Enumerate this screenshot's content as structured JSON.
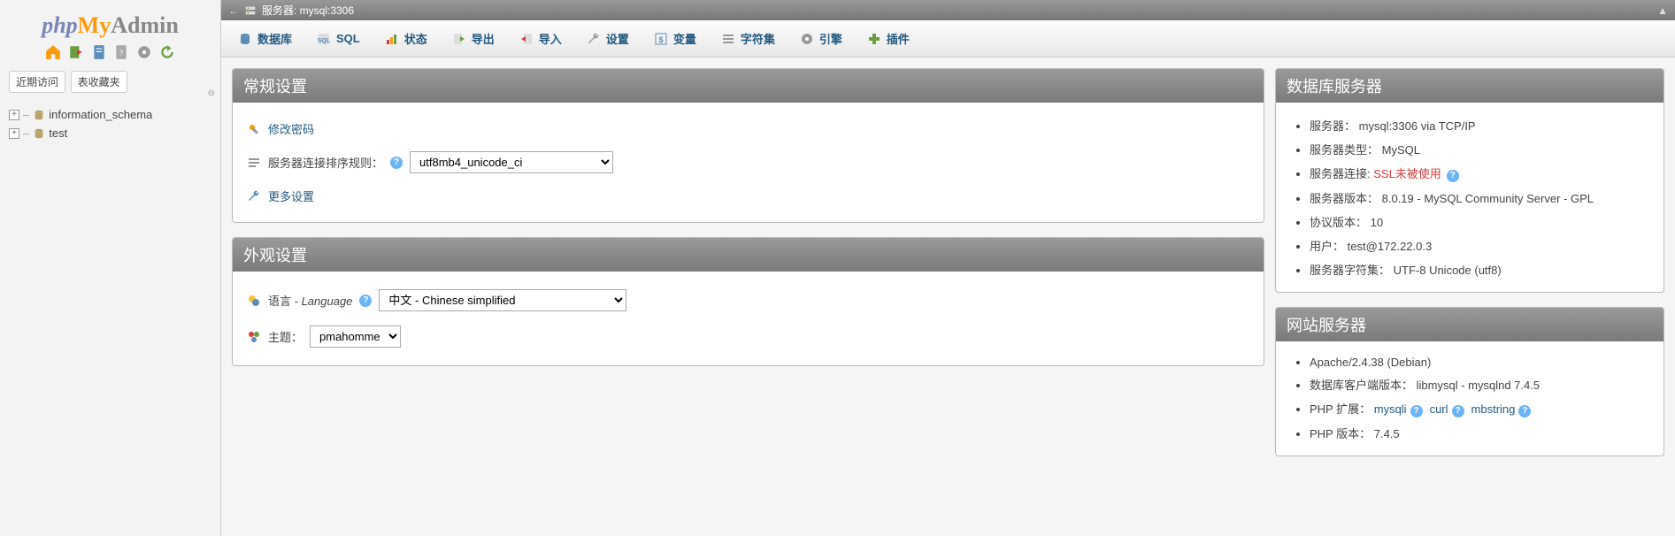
{
  "logo": {
    "php": "php",
    "my": "My",
    "admin": "Admin"
  },
  "sidebar": {
    "tabs": {
      "recent": "近期访问",
      "fav": "表收藏夹"
    },
    "dbs": [
      "information_schema",
      "test"
    ]
  },
  "breadcrumb": {
    "label": "服务器: mysql:3306"
  },
  "topmenu": [
    {
      "label": "数据库"
    },
    {
      "label": "SQL"
    },
    {
      "label": "状态"
    },
    {
      "label": "导出"
    },
    {
      "label": "导入"
    },
    {
      "label": "设置"
    },
    {
      "label": "变量"
    },
    {
      "label": "字符集"
    },
    {
      "label": "引擎"
    },
    {
      "label": "插件"
    }
  ],
  "general": {
    "title": "常规设置",
    "change_pw": "修改密码",
    "collation_label": "服务器连接排序规则：",
    "collation_value": "utf8mb4_unicode_ci",
    "more": "更多设置"
  },
  "appearance": {
    "title": "外观设置",
    "lang_label": "语言 - ",
    "lang_label2": "Language",
    "lang_value": "中文 - Chinese simplified",
    "theme_label": "主题：",
    "theme_value": "pmahomme"
  },
  "dbserver": {
    "title": "数据库服务器",
    "items": [
      {
        "k": "服务器：",
        "v": "mysql:3306 via TCP/IP"
      },
      {
        "k": "服务器类型：",
        "v": "MySQL"
      },
      {
        "k": "服务器连接:",
        "v": "SSL未被使用",
        "red": true,
        "help": true
      },
      {
        "k": "服务器版本：",
        "v": "8.0.19 - MySQL Community Server - GPL"
      },
      {
        "k": "协议版本：",
        "v": "10"
      },
      {
        "k": "用户：",
        "v": "test@172.22.0.3"
      },
      {
        "k": "服务器字符集：",
        "v": "UTF-8 Unicode (utf8)"
      }
    ]
  },
  "webserver": {
    "title": "网站服务器",
    "apache": "Apache/2.4.38 (Debian)",
    "client_label": "数据库客户端版本：",
    "client_value": "libmysql - mysqlnd 7.4.5",
    "phpext_label": "PHP 扩展：",
    "phpext": [
      "mysqli",
      "curl",
      "mbstring"
    ],
    "phpver_label": "PHP 版本：",
    "phpver_value": "7.4.5"
  }
}
